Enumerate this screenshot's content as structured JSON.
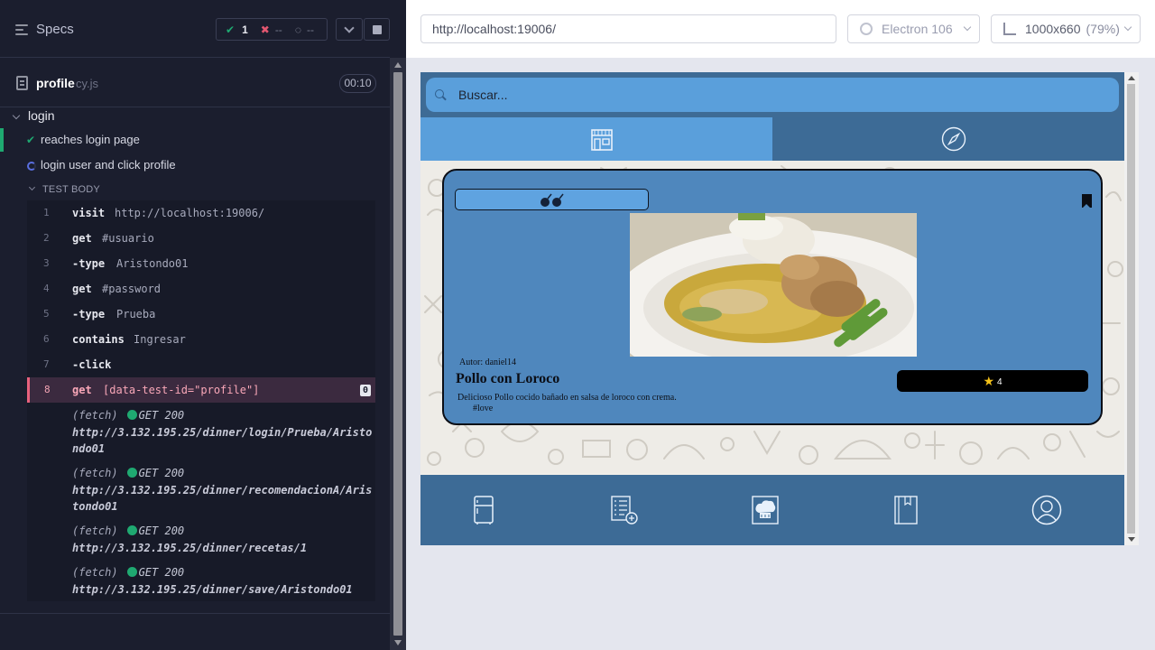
{
  "reporter": {
    "header": {
      "specs_label": "Specs"
    },
    "stats": {
      "passed": "1",
      "failed": "--",
      "pending": "--"
    },
    "spec": {
      "name": "profile",
      "ext": "cy.js",
      "duration": "00:10"
    },
    "suite": {
      "name": "login"
    },
    "tests": [
      {
        "label": "reaches login page",
        "state": "passed"
      },
      {
        "label": "login user and click profile",
        "state": "running"
      }
    ],
    "test_body_label": "TEST BODY",
    "commands": [
      {
        "num": "1",
        "name": "visit",
        "arg": "http://localhost:19006/"
      },
      {
        "num": "2",
        "name": "get",
        "arg": "#usuario"
      },
      {
        "num": "3",
        "name": "-type",
        "arg": "Aristondo01"
      },
      {
        "num": "4",
        "name": "get",
        "arg": "#password"
      },
      {
        "num": "5",
        "name": "-type",
        "arg": "Prueba"
      },
      {
        "num": "6",
        "name": "contains",
        "arg": "Ingresar"
      },
      {
        "num": "7",
        "name": "-click",
        "arg": ""
      },
      {
        "num": "8",
        "name": "get",
        "arg": "[data-test-id=\"profile\"]",
        "badge": "0"
      }
    ],
    "fetches": [
      {
        "kind": "(fetch)",
        "method": "GET 200",
        "url": "http://3.132.195.25/dinner/login/Prueba/Aristondo01"
      },
      {
        "kind": "(fetch)",
        "method": "GET 200",
        "url": "http://3.132.195.25/dinner/recomendacionA/Aristondo01"
      },
      {
        "kind": "(fetch)",
        "method": "GET 200",
        "url": "http://3.132.195.25/dinner/recetas/1"
      },
      {
        "kind": "(fetch)",
        "method": "GET 200",
        "url": "http://3.132.195.25/dinner/save/Aristondo01"
      }
    ]
  },
  "browser": {
    "url": "http://localhost:19006/",
    "browser_name": "Electron 106",
    "viewport": "1000x660",
    "zoom": "(79%)"
  },
  "app": {
    "search_placeholder": "Buscar...",
    "tabs": [
      {
        "icon": "store-icon",
        "active": true
      },
      {
        "icon": "compass-icon",
        "active": false
      }
    ],
    "card": {
      "author": "Autor: daniel14",
      "title": "Pollo con Loroco",
      "description": "Delicioso Pollo cocido bañado en salsa de loroco con crema.",
      "tag": "#love",
      "rating": "4"
    },
    "bottom_nav": [
      {
        "icon": "fridge-icon"
      },
      {
        "icon": "recipe-list-add-icon"
      },
      {
        "icon": "chef-hat-icon"
      },
      {
        "icon": "recipe-book-icon"
      },
      {
        "icon": "user-profile-icon"
      }
    ]
  },
  "colors": {
    "reporter_bg": "#1b1e2e",
    "passed": "#1fa971",
    "failed": "#e45770",
    "active_command": "#e8617d",
    "app_header": "#3d6b96",
    "app_accent": "#5a9fdb",
    "card": "#4f87bd"
  }
}
